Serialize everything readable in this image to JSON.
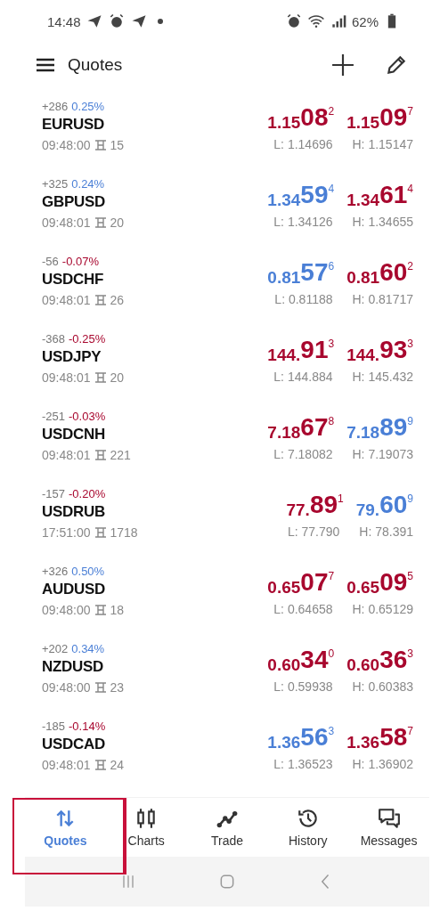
{
  "status_bar": {
    "time": "14:48",
    "battery": "62%"
  },
  "header": {
    "title": "Quotes"
  },
  "quotes": [
    {
      "change": "+286",
      "percent": {
        "text": "0.25%",
        "color": "#4a7fd6"
      },
      "symbol": "EURUSD",
      "time": "09:48:00",
      "spread": "15",
      "bid": {
        "pre": "1.15",
        "big": "08",
        "sup": "2",
        "color": "#a8072e"
      },
      "ask": {
        "pre": "1.15",
        "big": "09",
        "sup": "7",
        "color": "#a8072e"
      },
      "low": "L: 1.14696",
      "high": "H: 1.15147"
    },
    {
      "change": "+325",
      "percent": {
        "text": "0.24%",
        "color": "#4a7fd6"
      },
      "symbol": "GBPUSD",
      "time": "09:48:01",
      "spread": "20",
      "bid": {
        "pre": "1.34",
        "big": "59",
        "sup": "4",
        "color": "#4a7fd6"
      },
      "ask": {
        "pre": "1.34",
        "big": "61",
        "sup": "4",
        "color": "#a8072e"
      },
      "low": "L: 1.34126",
      "high": "H: 1.34655"
    },
    {
      "change": "-56",
      "percent": {
        "text": "-0.07%",
        "color": "#a8072e"
      },
      "symbol": "USDCHF",
      "time": "09:48:01",
      "spread": "26",
      "bid": {
        "pre": "0.81",
        "big": "57",
        "sup": "6",
        "color": "#4a7fd6"
      },
      "ask": {
        "pre": "0.81",
        "big": "60",
        "sup": "2",
        "color": "#a8072e"
      },
      "low": "L: 0.81188",
      "high": "H: 0.81717"
    },
    {
      "change": "-368",
      "percent": {
        "text": "-0.25%",
        "color": "#a8072e"
      },
      "symbol": "USDJPY",
      "time": "09:48:01",
      "spread": "20",
      "bid": {
        "pre": "144.",
        "big": "91",
        "sup": "3",
        "color": "#a8072e"
      },
      "ask": {
        "pre": "144.",
        "big": "93",
        "sup": "3",
        "color": "#a8072e"
      },
      "low": "L: 144.884",
      "high": "H: 145.432"
    },
    {
      "change": "-251",
      "percent": {
        "text": "-0.03%",
        "color": "#a8072e"
      },
      "symbol": "USDCNH",
      "time": "09:48:01",
      "spread": "221",
      "bid": {
        "pre": "7.18",
        "big": "67",
        "sup": "8",
        "color": "#a8072e"
      },
      "ask": {
        "pre": "7.18",
        "big": "89",
        "sup": "9",
        "color": "#4a7fd6"
      },
      "low": "L: 7.18082",
      "high": "H: 7.19073"
    },
    {
      "change": "-157",
      "percent": {
        "text": "-0.20%",
        "color": "#a8072e"
      },
      "symbol": "USDRUB",
      "time": "17:51:00",
      "spread": "1718",
      "bid": {
        "pre": "77.",
        "big": "89",
        "sup": "1",
        "color": "#a8072e"
      },
      "ask": {
        "pre": "79.",
        "big": "60",
        "sup": "9",
        "color": "#4a7fd6"
      },
      "low": "L: 77.790",
      "high": "H: 78.391"
    },
    {
      "change": "+326",
      "percent": {
        "text": "0.50%",
        "color": "#4a7fd6"
      },
      "symbol": "AUDUSD",
      "time": "09:48:00",
      "spread": "18",
      "bid": {
        "pre": "0.65",
        "big": "07",
        "sup": "7",
        "color": "#a8072e"
      },
      "ask": {
        "pre": "0.65",
        "big": "09",
        "sup": "5",
        "color": "#a8072e"
      },
      "low": "L: 0.64658",
      "high": "H: 0.65129"
    },
    {
      "change": "+202",
      "percent": {
        "text": "0.34%",
        "color": "#4a7fd6"
      },
      "symbol": "NZDUSD",
      "time": "09:48:00",
      "spread": "23",
      "bid": {
        "pre": "0.60",
        "big": "34",
        "sup": "0",
        "color": "#a8072e"
      },
      "ask": {
        "pre": "0.60",
        "big": "36",
        "sup": "3",
        "color": "#a8072e"
      },
      "low": "L: 0.59938",
      "high": "H: 0.60383"
    },
    {
      "change": "-185",
      "percent": {
        "text": "-0.14%",
        "color": "#a8072e"
      },
      "symbol": "USDCAD",
      "time": "09:48:01",
      "spread": "24",
      "bid": {
        "pre": "1.36",
        "big": "56",
        "sup": "3",
        "color": "#4a7fd6"
      },
      "ask": {
        "pre": "1.36",
        "big": "58",
        "sup": "7",
        "color": "#a8072e"
      },
      "low": "L: 1.36523",
      "high": "H: 1.36902"
    }
  ],
  "tabs": [
    {
      "kind": "quotes",
      "label": "Quotes",
      "selected": true,
      "highlighted": true
    },
    {
      "kind": "charts",
      "label": "Charts",
      "selected": false,
      "highlighted": false
    },
    {
      "kind": "trade",
      "label": "Trade",
      "selected": false,
      "highlighted": false
    },
    {
      "kind": "history",
      "label": "History",
      "selected": false,
      "highlighted": false
    },
    {
      "kind": "messages",
      "label": "Messages",
      "selected": false,
      "highlighted": false
    }
  ]
}
